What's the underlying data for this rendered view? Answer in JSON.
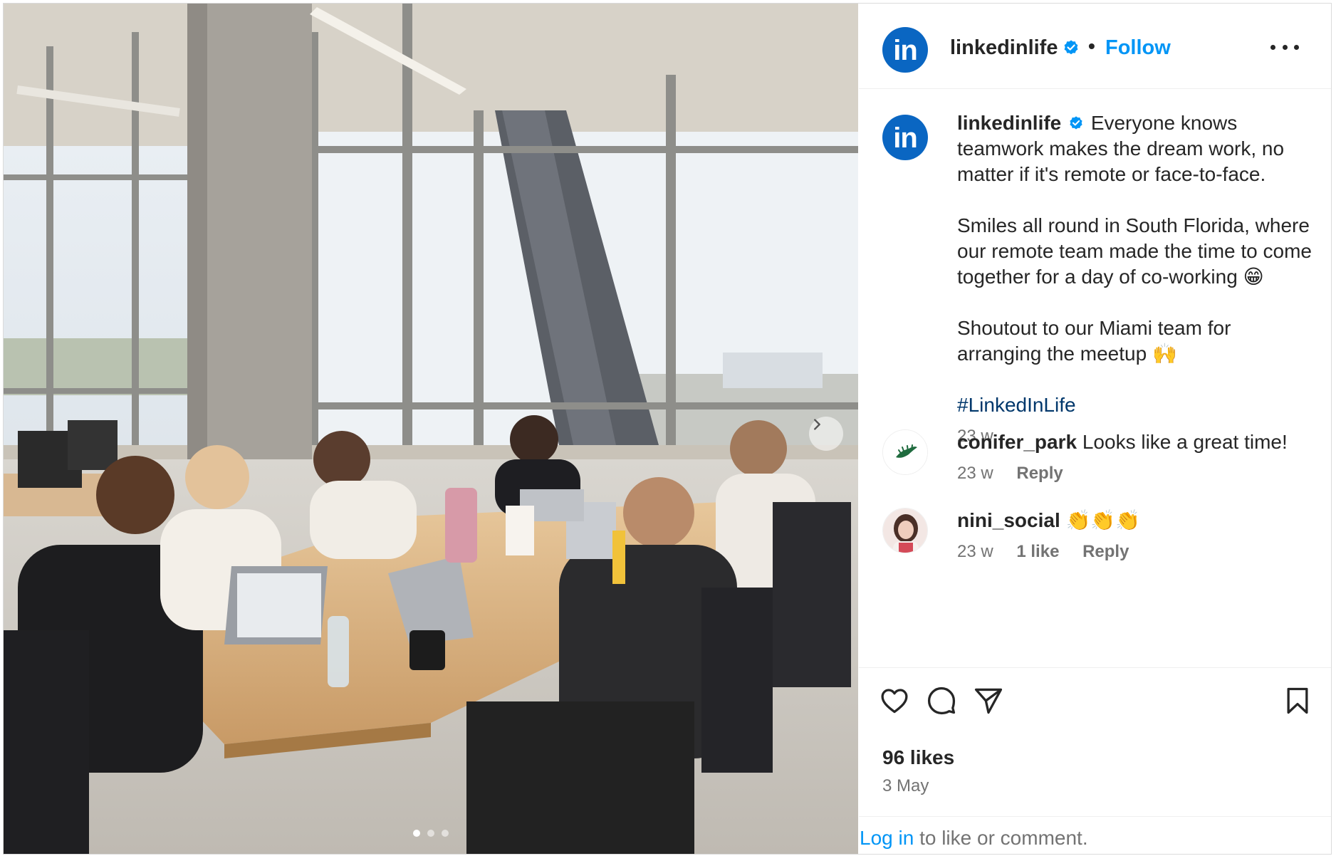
{
  "post": {
    "author": "linkedinlife",
    "follow_label": "Follow",
    "separator": "•",
    "avatar_text": "in"
  },
  "caption": {
    "author": "linkedinlife",
    "line1": "Everyone knows teamwork makes the dream work, no matter if it's remote or face-to-face.",
    "line2": "Smiles all round in South Florida, where our remote team made the time to come together for a day of co-working 😁",
    "line3": "Shoutout to our Miami team for arranging the meetup 🙌",
    "hashtag": "#LinkedInLife",
    "time": "23 w"
  },
  "comments": [
    {
      "author": "conifer_park",
      "text": "Looks like a great time!",
      "time": "23 w",
      "likes": "",
      "reply": "Reply"
    },
    {
      "author": "nini_social",
      "text": "👏👏👏",
      "time": "23 w",
      "likes": "1 like",
      "reply": "Reply"
    }
  ],
  "footer": {
    "likes": "96 likes",
    "date": "3 May",
    "login_link": "Log in",
    "login_suffix": " to like or comment."
  },
  "carousel": {
    "total": 3,
    "active": 1
  },
  "colors": {
    "accent": "#0095f6",
    "linkedin": "#0a66c2",
    "hashtag": "#00376b",
    "muted": "#737373"
  },
  "icons": [
    "more-icon",
    "heart-icon",
    "comment-icon",
    "share-icon",
    "bookmark-icon",
    "verified-icon",
    "chevron-right-icon"
  ]
}
